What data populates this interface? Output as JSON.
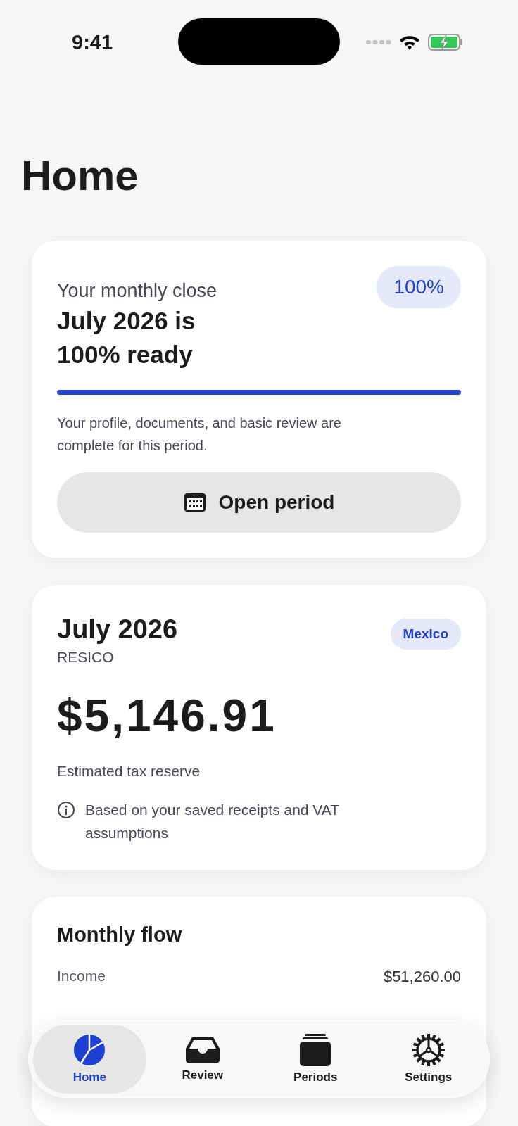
{
  "status_bar": {
    "time": "9:41"
  },
  "title": "Home",
  "close_card": {
    "label": "Your monthly close",
    "badge": "100%",
    "headline": "July 2026 is 100% ready",
    "level": 1,
    "description": "Your profile, documents, and basic review are complete for this period.",
    "button": "Open period"
  },
  "period_card": {
    "title": "July 2026",
    "regime": "RESICO",
    "country": "Mexico",
    "amount": "$5,146.91",
    "amount_label": "Estimated tax reserve",
    "note": "Based on your saved receipts and VAT assumptions"
  },
  "flow_card": {
    "title": "Monthly flow",
    "rows": [
      {
        "label": "Income",
        "value": "$51,260.00"
      }
    ]
  },
  "tab_bar": [
    {
      "kind": "home",
      "label": "Home",
      "selected": true
    },
    {
      "kind": "review",
      "label": "Review",
      "selected": false
    },
    {
      "kind": "periods",
      "label": "Periods",
      "selected": false
    },
    {
      "kind": "settings",
      "label": "Settings",
      "selected": false
    }
  ]
}
